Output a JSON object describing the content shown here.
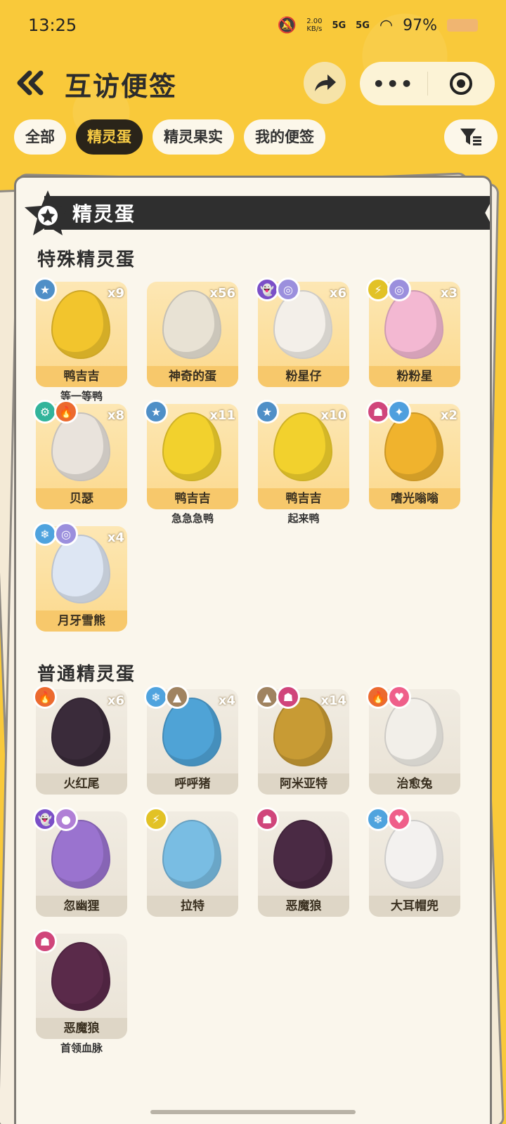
{
  "status": {
    "time": "13:25",
    "net_speed_value": "2.00",
    "net_speed_unit": "KB/s",
    "signal1": "5G",
    "signal2": "5G",
    "battery": "97%"
  },
  "header": {
    "title": "互访便签",
    "more_label": "•••"
  },
  "tabs": [
    {
      "label": "全部",
      "active": false
    },
    {
      "label": "精灵蛋",
      "active": true
    },
    {
      "label": "精灵果实",
      "active": false
    },
    {
      "label": "我的便签",
      "active": false
    }
  ],
  "banner": {
    "title": "精灵蛋"
  },
  "sections": {
    "special_title": "特殊精灵蛋",
    "normal_title": "普通精灵蛋"
  },
  "special_eggs": [
    {
      "name": "鸭吉吉",
      "count": "x9",
      "sub": "等一等鸭",
      "types": [
        "star-icon"
      ],
      "colors": [
        "#4f8fc7"
      ],
      "egg": "#f2c52d"
    },
    {
      "name": "神奇的蛋",
      "count": "x56",
      "sub": "",
      "types": [],
      "colors": [],
      "egg": "#e8e2d4"
    },
    {
      "name": "粉星仔",
      "count": "x6",
      "sub": "",
      "types": [
        "ghost-icon",
        "spiral-icon"
      ],
      "colors": [
        "#7b4fc7",
        "#9b8fdd"
      ],
      "egg": "#f3efe9"
    },
    {
      "name": "粉粉星",
      "count": "x3",
      "sub": "",
      "types": [
        "lightning-icon",
        "spiral-icon"
      ],
      "colors": [
        "#e2c226",
        "#9b8fdd"
      ],
      "egg": "#f3b8d2"
    },
    {
      "name": "贝瑟",
      "count": "x8",
      "sub": "",
      "types": [
        "gear-icon",
        "fire-icon"
      ],
      "colors": [
        "#32b49b",
        "#ec6a2f"
      ],
      "egg": "#e9e3dc"
    },
    {
      "name": "鸭吉吉",
      "count": "x11",
      "sub": "急急急鸭",
      "types": [
        "star-icon"
      ],
      "colors": [
        "#4f8fc7"
      ],
      "egg": "#f2d12d"
    },
    {
      "name": "鸭吉吉",
      "count": "x10",
      "sub": "起来鸭",
      "types": [
        "star-icon"
      ],
      "colors": [
        "#4f8fc7"
      ],
      "egg": "#f2d12d"
    },
    {
      "name": "嗜光嗡嗡",
      "count": "x2",
      "sub": "",
      "types": [
        "demon-icon",
        "crystal-icon"
      ],
      "colors": [
        "#d0457b",
        "#4f9fde"
      ],
      "egg": "#f0b32d"
    },
    {
      "name": "月牙雪熊",
      "count": "x4",
      "sub": "",
      "types": [
        "snowflake-icon",
        "spiral-icon"
      ],
      "colors": [
        "#4fa3de",
        "#9b8fdd"
      ],
      "egg": "#dde6f3"
    }
  ],
  "normal_eggs": [
    {
      "name": "火红尾",
      "count": "x6",
      "sub": "",
      "types": [
        "fire-icon"
      ],
      "colors": [
        "#ec6a2f"
      ],
      "egg": "#3a2b3a"
    },
    {
      "name": "呼呼猪",
      "count": "x4",
      "sub": "",
      "types": [
        "snowflake-icon",
        "mountain-icon"
      ],
      "colors": [
        "#4fa3de",
        "#a08360"
      ],
      "egg": "#4fa3d6"
    },
    {
      "name": "阿米亚特",
      "count": "x14",
      "sub": "",
      "types": [
        "mountain-icon",
        "demon-icon"
      ],
      "colors": [
        "#a08360",
        "#d0457b"
      ],
      "egg": "#c89b34"
    },
    {
      "name": "治愈兔",
      "count": "",
      "sub": "",
      "types": [
        "fire-icon",
        "heart-icon"
      ],
      "colors": [
        "#ec6a2f",
        "#ef5f8a"
      ],
      "egg": "#f2efe9"
    },
    {
      "name": "忽幽狸",
      "count": "",
      "sub": "",
      "types": [
        "ghost-icon",
        "bubble-icon"
      ],
      "colors": [
        "#7b4fc7",
        "#b07fd6"
      ],
      "egg": "#9a73cf"
    },
    {
      "name": "拉特",
      "count": "",
      "sub": "",
      "types": [
        "lightning-icon"
      ],
      "colors": [
        "#e2c226"
      ],
      "egg": "#79bde3"
    },
    {
      "name": "恶魔狼",
      "count": "",
      "sub": "",
      "types": [
        "demon-icon"
      ],
      "colors": [
        "#d0457b"
      ],
      "egg": "#4a2a44"
    },
    {
      "name": "大耳帽兜",
      "count": "",
      "sub": "",
      "types": [
        "snowflake-icon",
        "heart-icon"
      ],
      "colors": [
        "#4fa3de",
        "#ef5f8a"
      ],
      "egg": "#f3f1ef"
    },
    {
      "name": "恶魔狼",
      "count": "",
      "sub": "首领血脉",
      "types": [
        "demon-icon"
      ],
      "colors": [
        "#d0457b"
      ],
      "egg": "#5a2a4a"
    }
  ]
}
